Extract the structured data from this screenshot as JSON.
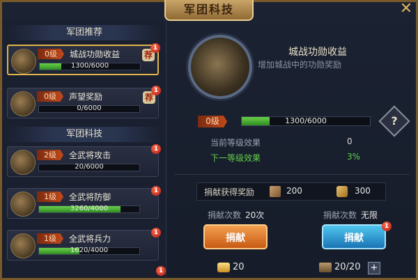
{
  "window": {
    "title": "军团科技",
    "close_icon": "close-icon"
  },
  "left": {
    "recommend_header": "军团推荐",
    "tech_header": "军团科技",
    "recommend_items": [
      {
        "level": "0级",
        "name": "城战功勋收益",
        "progress_text": "1300/6000",
        "progress": 0.217,
        "badge": "荐",
        "notice": "1",
        "active": true
      },
      {
        "level": "0级",
        "name": "声望奖励",
        "progress_text": "0/6000",
        "progress": 0.0,
        "badge": "荐",
        "notice": "1",
        "active": false
      }
    ],
    "tech_items": [
      {
        "level": "2级",
        "name": "全武将攻击",
        "progress_text": "20/6000",
        "progress": 0.003,
        "notice": "1"
      },
      {
        "level": "1级",
        "name": "全武将防御",
        "progress_text": "3260/4000",
        "progress": 0.815,
        "notice": "1"
      },
      {
        "level": "1级",
        "name": "全武将兵力",
        "progress_text": "1620/4000",
        "progress": 0.405,
        "notice": "1"
      }
    ],
    "bottom_notice": "1"
  },
  "detail": {
    "title": "城战功勋收益",
    "subtitle": "增加城战中的功勋奖励",
    "level": "0级",
    "progress_text": "1300/6000",
    "progress": 0.217,
    "help": "?",
    "current_label": "当前等级效果",
    "current_value": "0",
    "next_label": "下一等级效果",
    "next_value": "3%",
    "reward_label": "捐献获得奖励",
    "reward_a": "200",
    "reward_b": "300",
    "count_label_a": "捐献次数",
    "count_value_a": "20次",
    "count_label_b": "捐献次数",
    "count_value_b": "无限",
    "donate_label": "捐献",
    "donate_notice": "1",
    "cost_a": "20",
    "cost_b": "20/20",
    "plus": "+"
  }
}
